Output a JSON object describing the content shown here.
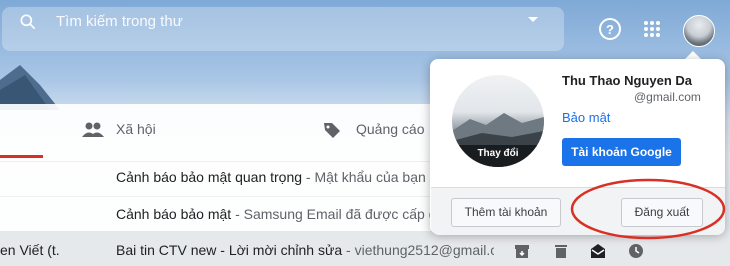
{
  "search": {
    "placeholder": "Tìm kiếm trong thư"
  },
  "categories": [
    {
      "label": "Xã hội",
      "icon": "people-icon"
    },
    {
      "label": "Quảng cáo",
      "icon": "tag-icon"
    }
  ],
  "emails": [
    {
      "sender": "",
      "subject": "Cảnh báo bảo mật quan trọng",
      "snippet": " - Mật khẩu của bạn đ"
    },
    {
      "sender": "",
      "subject": "Cảnh báo bảo mật",
      "snippet": " - Samsung Email đã được cấp qu"
    },
    {
      "sender": "en Viết (t.",
      "subject": "Bai tin CTV new - Lời mời chỉnh sửa",
      "snippet": " - viethung2512@gmail.c"
    }
  ],
  "row_actions": [
    "archive-icon",
    "delete-icon",
    "mark-read-icon",
    "snooze-icon"
  ],
  "account": {
    "name": "Thu Thao Nguyen Da",
    "email": "@gmail.com",
    "avatar_caption": "Thay đổi",
    "privacy_link": "Bảo mật",
    "google_account_button": "Tài khoản Google",
    "add_account_button": "Thêm tài khoản",
    "sign_out_button": "Đăng xuất"
  },
  "colors": {
    "accent": "#1a73e8",
    "highlight": "#d93025"
  }
}
